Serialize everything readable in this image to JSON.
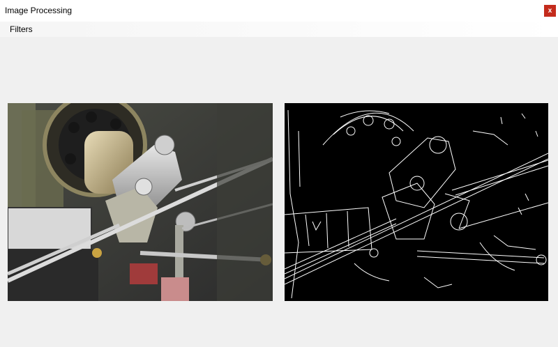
{
  "window": {
    "title": "Image Processing",
    "close_glyph": "x",
    "close_color": "#c42b1c"
  },
  "menu": {
    "items": [
      "Filters"
    ]
  },
  "images": {
    "original": {
      "description_icon": "photo-mechanical-linkage"
    },
    "processed": {
      "description_icon": "edge-detection-output"
    }
  }
}
